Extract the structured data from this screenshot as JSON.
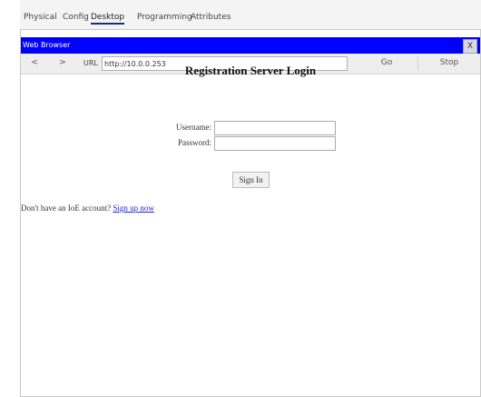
{
  "tabs": [
    "Physical",
    "Config",
    "Desktop",
    "Programming",
    "Attributes"
  ],
  "active_tab": "Desktop",
  "browser": {
    "title": "Web Browser",
    "close_label": "X",
    "back_label": "<",
    "forward_label": ">",
    "url_label": "URL",
    "url_value": "http://10.0.0.253",
    "go_label": "Go",
    "stop_label": "Stop"
  },
  "page": {
    "heading": "Registration Server Login",
    "username_label": "Username:",
    "password_label": "Password:",
    "signin_label": "Sign In",
    "signup_prompt": "Don't have an IoE account?",
    "signup_link": "Sign up now"
  },
  "colors": {
    "titlebar": "#0000ff",
    "link": "#2222cc",
    "active_tab_underline": "#1a2f7a"
  }
}
